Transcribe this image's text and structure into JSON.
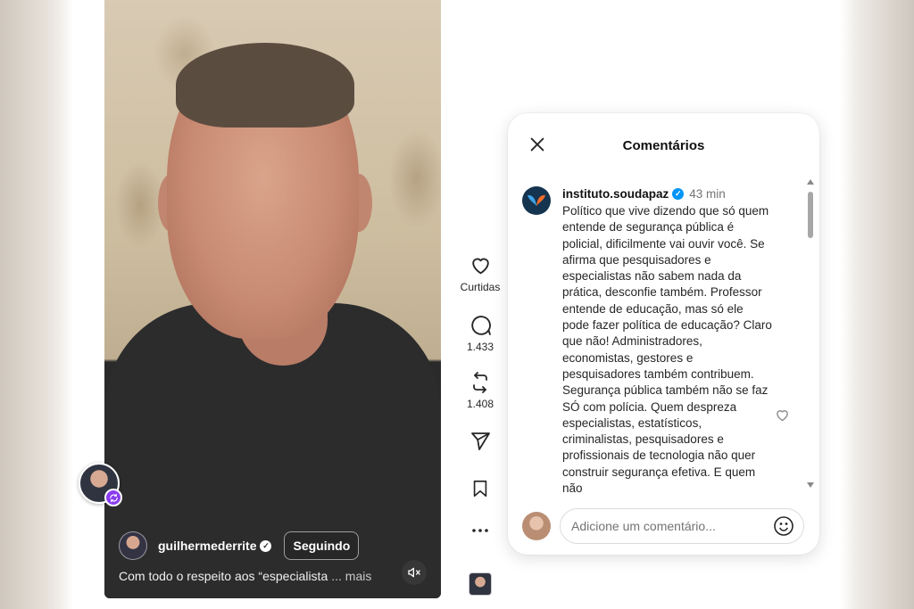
{
  "video": {
    "author": "guilhermederrite",
    "follow_label": "Seguindo",
    "caption": "Com todo o respeito aos “especialista",
    "caption_more": "... mais"
  },
  "actions": {
    "likes_label": "Curtidas",
    "comments_count": "1.433",
    "reposts_count": "1.408"
  },
  "comments_panel": {
    "title": "Comentários",
    "comment": {
      "user": "instituto.soudapaz",
      "time": "43 min",
      "text": "Político que vive dizendo que só quem entende de segurança pública é policial, dificilmente vai ouvir você. Se afirma que pesquisadores e especialistas não sabem nada da prática, desconfie também. Professor entende de educação, mas só ele pode fazer política de educação? Claro que não! Administradores, economistas, gestores e pesquisadores também contribuem. Segurança pública também não se faz SÓ com polícia. Quem despreza especialistas, estatísticos, criminalistas, pesquisadores e profissionais de tecnologia não quer construir segurança efetiva. E quem não"
    },
    "input_placeholder": "Adicione um comentário..."
  },
  "colors": {
    "verified": "#0095f6",
    "repost_badge": "#8a3cf0"
  }
}
